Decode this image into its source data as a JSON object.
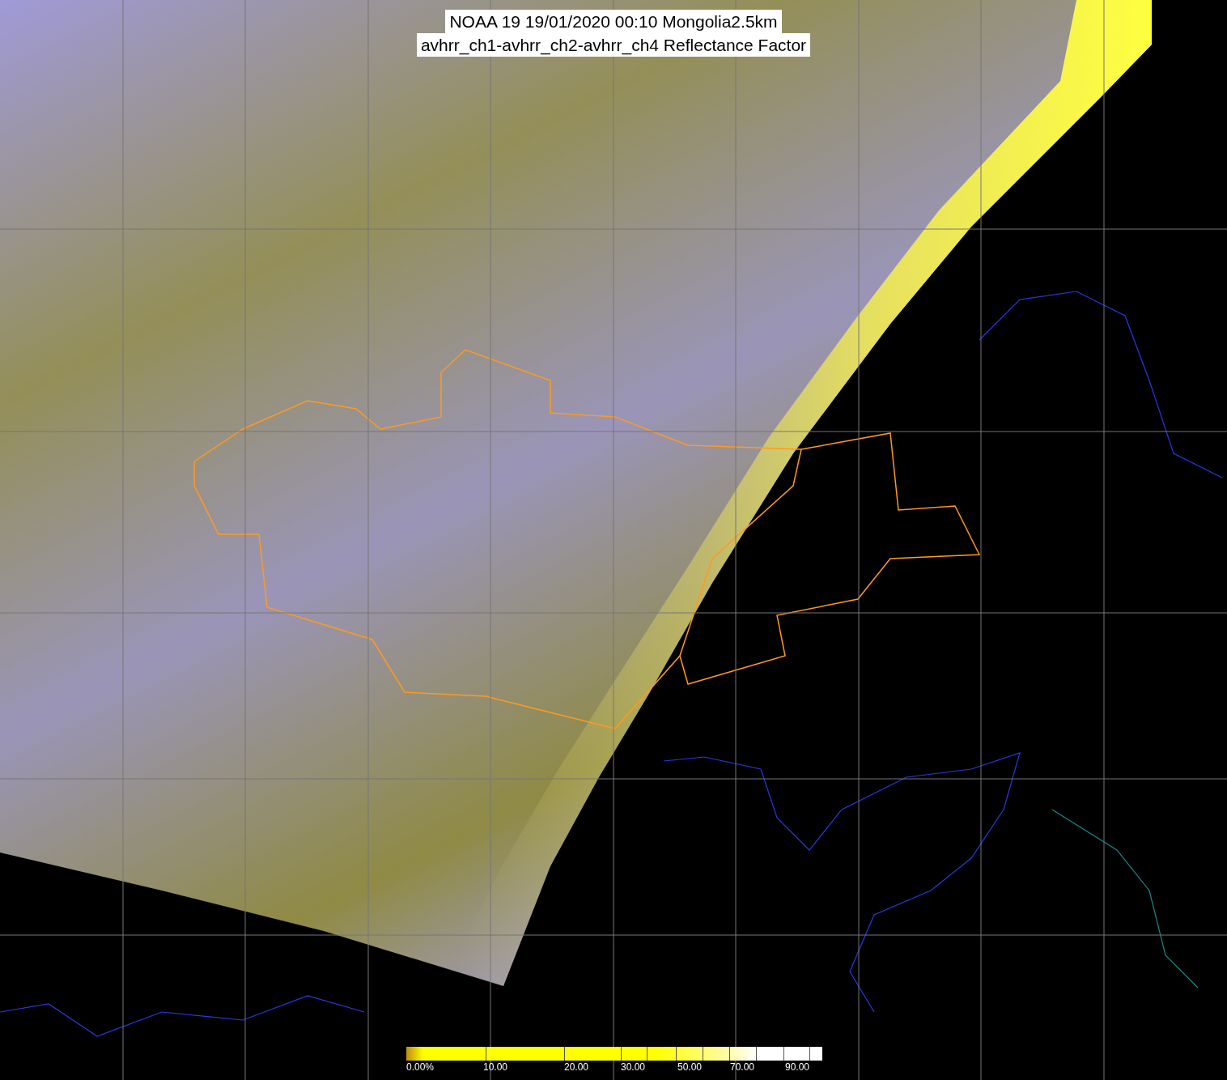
{
  "title": {
    "lines": [
      "NOAA 19 19/01/2020 00:10 Mongolia2.5km",
      "avhrr_ch1-avhrr_ch2-avhrr_ch4 Reflectance Factor"
    ]
  },
  "colorbar": {
    "labels": [
      "0.00%",
      "10.00",
      "20.00",
      "30.00",
      "50.00",
      "70.00",
      "90.00"
    ]
  }
}
